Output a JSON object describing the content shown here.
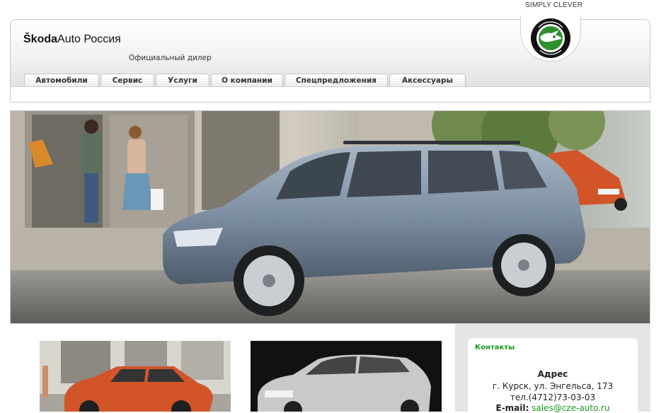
{
  "header": {
    "slogan": "SIMPLY CLEVER",
    "brand_bold": "Škoda",
    "brand_rest": "Auto Россия",
    "dealer": "Официальный дилер"
  },
  "nav": {
    "items": [
      {
        "label": "Автомобили"
      },
      {
        "label": "Сервис"
      },
      {
        "label": "Услуги"
      },
      {
        "label": "О компании"
      },
      {
        "label": "Спецпредложения"
      },
      {
        "label": "Аксессуары"
      }
    ]
  },
  "contacts": {
    "title": "Контакты",
    "address_title": "Адрес",
    "address": "г. Курск, ул. Энгельса, 173",
    "phone": "тел.(4712)73-03-03",
    "email_label": "E-mail:",
    "email": "sales@cze-auto.ru"
  },
  "colors": {
    "accent_green": "#1a9a1a",
    "logo_green": "#2f8f2f",
    "car_blue": "#7d8fa3",
    "car_orange": "#d2552a"
  },
  "icons": {
    "logo": "skoda-winged-arrow-logo"
  }
}
